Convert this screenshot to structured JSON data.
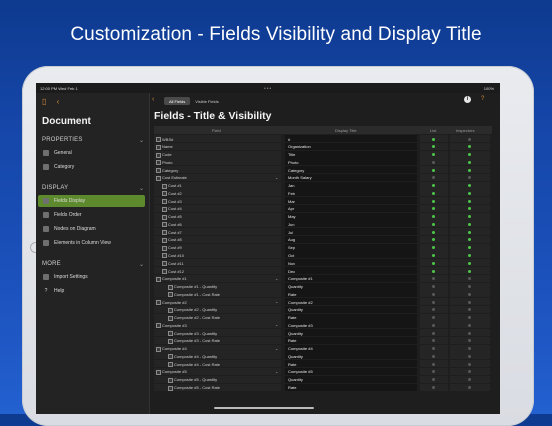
{
  "banner": {
    "title": "Customization - Fields Visibility and Display Title"
  },
  "status": {
    "time": "12:00 PM  Wed Feb 1",
    "battery": "100%"
  },
  "sidebar": {
    "title": "Document",
    "sections": [
      {
        "label": "PROPERTIES",
        "items": [
          {
            "label": "General",
            "icon": "gear-icon"
          },
          {
            "label": "Category",
            "icon": "folder-icon"
          }
        ]
      },
      {
        "label": "DISPLAY",
        "items": [
          {
            "label": "Fields Display",
            "icon": "list-icon",
            "active": true
          },
          {
            "label": "Fields Order",
            "icon": "order-icon"
          },
          {
            "label": "Nodes on Diagram",
            "icon": "node-icon"
          },
          {
            "label": "Elements in Column View",
            "icon": "columns-icon"
          }
        ]
      },
      {
        "label": "MORE",
        "items": [
          {
            "label": "Import Settings",
            "icon": "import-icon"
          },
          {
            "label": "Help",
            "icon": "help-icon"
          }
        ]
      }
    ]
  },
  "topbar": {
    "seg_all": "All Fields",
    "seg_visible": "Visible Fields"
  },
  "page": {
    "title": "Fields - Title & Visibility",
    "columns": {
      "field": "Field",
      "display": "Display Title",
      "list": "List",
      "inspectors": "Inspectors"
    },
    "rows": [
      {
        "field": "WBS#",
        "display": "#",
        "list": true,
        "insp": false,
        "indent": 0
      },
      {
        "field": "Name",
        "display": "Organization",
        "list": true,
        "insp": true,
        "indent": 0
      },
      {
        "field": "Code",
        "display": "Title",
        "list": true,
        "insp": true,
        "indent": 0
      },
      {
        "field": "Photo",
        "display": "Photo",
        "list": false,
        "insp": true,
        "indent": 0
      },
      {
        "field": "Category",
        "display": "Category",
        "list": true,
        "insp": true,
        "indent": 0
      },
      {
        "field": "Cost Estimate",
        "display": "Month Salary",
        "list": false,
        "insp": false,
        "indent": 0,
        "expand": true
      },
      {
        "field": "Cost #1",
        "display": "Jan",
        "list": true,
        "insp": true,
        "indent": 1
      },
      {
        "field": "Cost #2",
        "display": "Feb",
        "list": true,
        "insp": true,
        "indent": 1
      },
      {
        "field": "Cost #3",
        "display": "Mar",
        "list": true,
        "insp": true,
        "indent": 1
      },
      {
        "field": "Cost #4",
        "display": "Apr",
        "list": true,
        "insp": true,
        "indent": 1
      },
      {
        "field": "Cost #5",
        "display": "May",
        "list": true,
        "insp": true,
        "indent": 1
      },
      {
        "field": "Cost #6",
        "display": "Jun",
        "list": true,
        "insp": true,
        "indent": 1
      },
      {
        "field": "Cost #7",
        "display": "Jul",
        "list": true,
        "insp": true,
        "indent": 1
      },
      {
        "field": "Cost #8",
        "display": "Aug",
        "list": true,
        "insp": true,
        "indent": 1
      },
      {
        "field": "Cost #9",
        "display": "Sep",
        "list": true,
        "insp": true,
        "indent": 1
      },
      {
        "field": "Cost #10",
        "display": "Oct",
        "list": true,
        "insp": true,
        "indent": 1
      },
      {
        "field": "Cost #11",
        "display": "Nov",
        "list": true,
        "insp": true,
        "indent": 1
      },
      {
        "field": "Cost #12",
        "display": "Dec",
        "list": true,
        "insp": true,
        "indent": 1
      },
      {
        "field": "Composite #1",
        "display": "Composite #1",
        "list": false,
        "insp": false,
        "indent": 0,
        "expand": true
      },
      {
        "field": "Composite #1 - Quantity",
        "display": "Quantity",
        "list": false,
        "insp": false,
        "indent": 2
      },
      {
        "field": "Composite #1 - Cost Rate",
        "display": "Rate",
        "list": false,
        "insp": false,
        "indent": 2
      },
      {
        "field": "Composite #2",
        "display": "Composite #2",
        "list": false,
        "insp": false,
        "indent": 0,
        "expand": true
      },
      {
        "field": "Composite #2 - Quantity",
        "display": "Quantity",
        "list": false,
        "insp": false,
        "indent": 2
      },
      {
        "field": "Composite #2 - Cost Rate",
        "display": "Rate",
        "list": false,
        "insp": false,
        "indent": 2
      },
      {
        "field": "Composite #3",
        "display": "Composite #3",
        "list": false,
        "insp": false,
        "indent": 0,
        "expand": true
      },
      {
        "field": "Composite #3 - Quantity",
        "display": "Quantity",
        "list": false,
        "insp": false,
        "indent": 2
      },
      {
        "field": "Composite #3 - Cost Rate",
        "display": "Rate",
        "list": false,
        "insp": false,
        "indent": 2
      },
      {
        "field": "Composite #4",
        "display": "Composite #4",
        "list": false,
        "insp": false,
        "indent": 0,
        "expand": true
      },
      {
        "field": "Composite #4 - Quantity",
        "display": "Quantity",
        "list": false,
        "insp": false,
        "indent": 2
      },
      {
        "field": "Composite #4 - Cost Rate",
        "display": "Rate",
        "list": false,
        "insp": false,
        "indent": 2
      },
      {
        "field": "Composite #5",
        "display": "Composite #5",
        "list": false,
        "insp": false,
        "indent": 0,
        "expand": true
      },
      {
        "field": "Composite #5 - Quantity",
        "display": "Quantity",
        "list": false,
        "insp": false,
        "indent": 2
      },
      {
        "field": "Composite #5 - Cost Rate",
        "display": "Rate",
        "list": false,
        "insp": false,
        "indent": 2
      }
    ]
  },
  "colors": {
    "accent": "#d08a3a",
    "active": "#5d8a2c",
    "toggle_on": "#4ec54a"
  }
}
